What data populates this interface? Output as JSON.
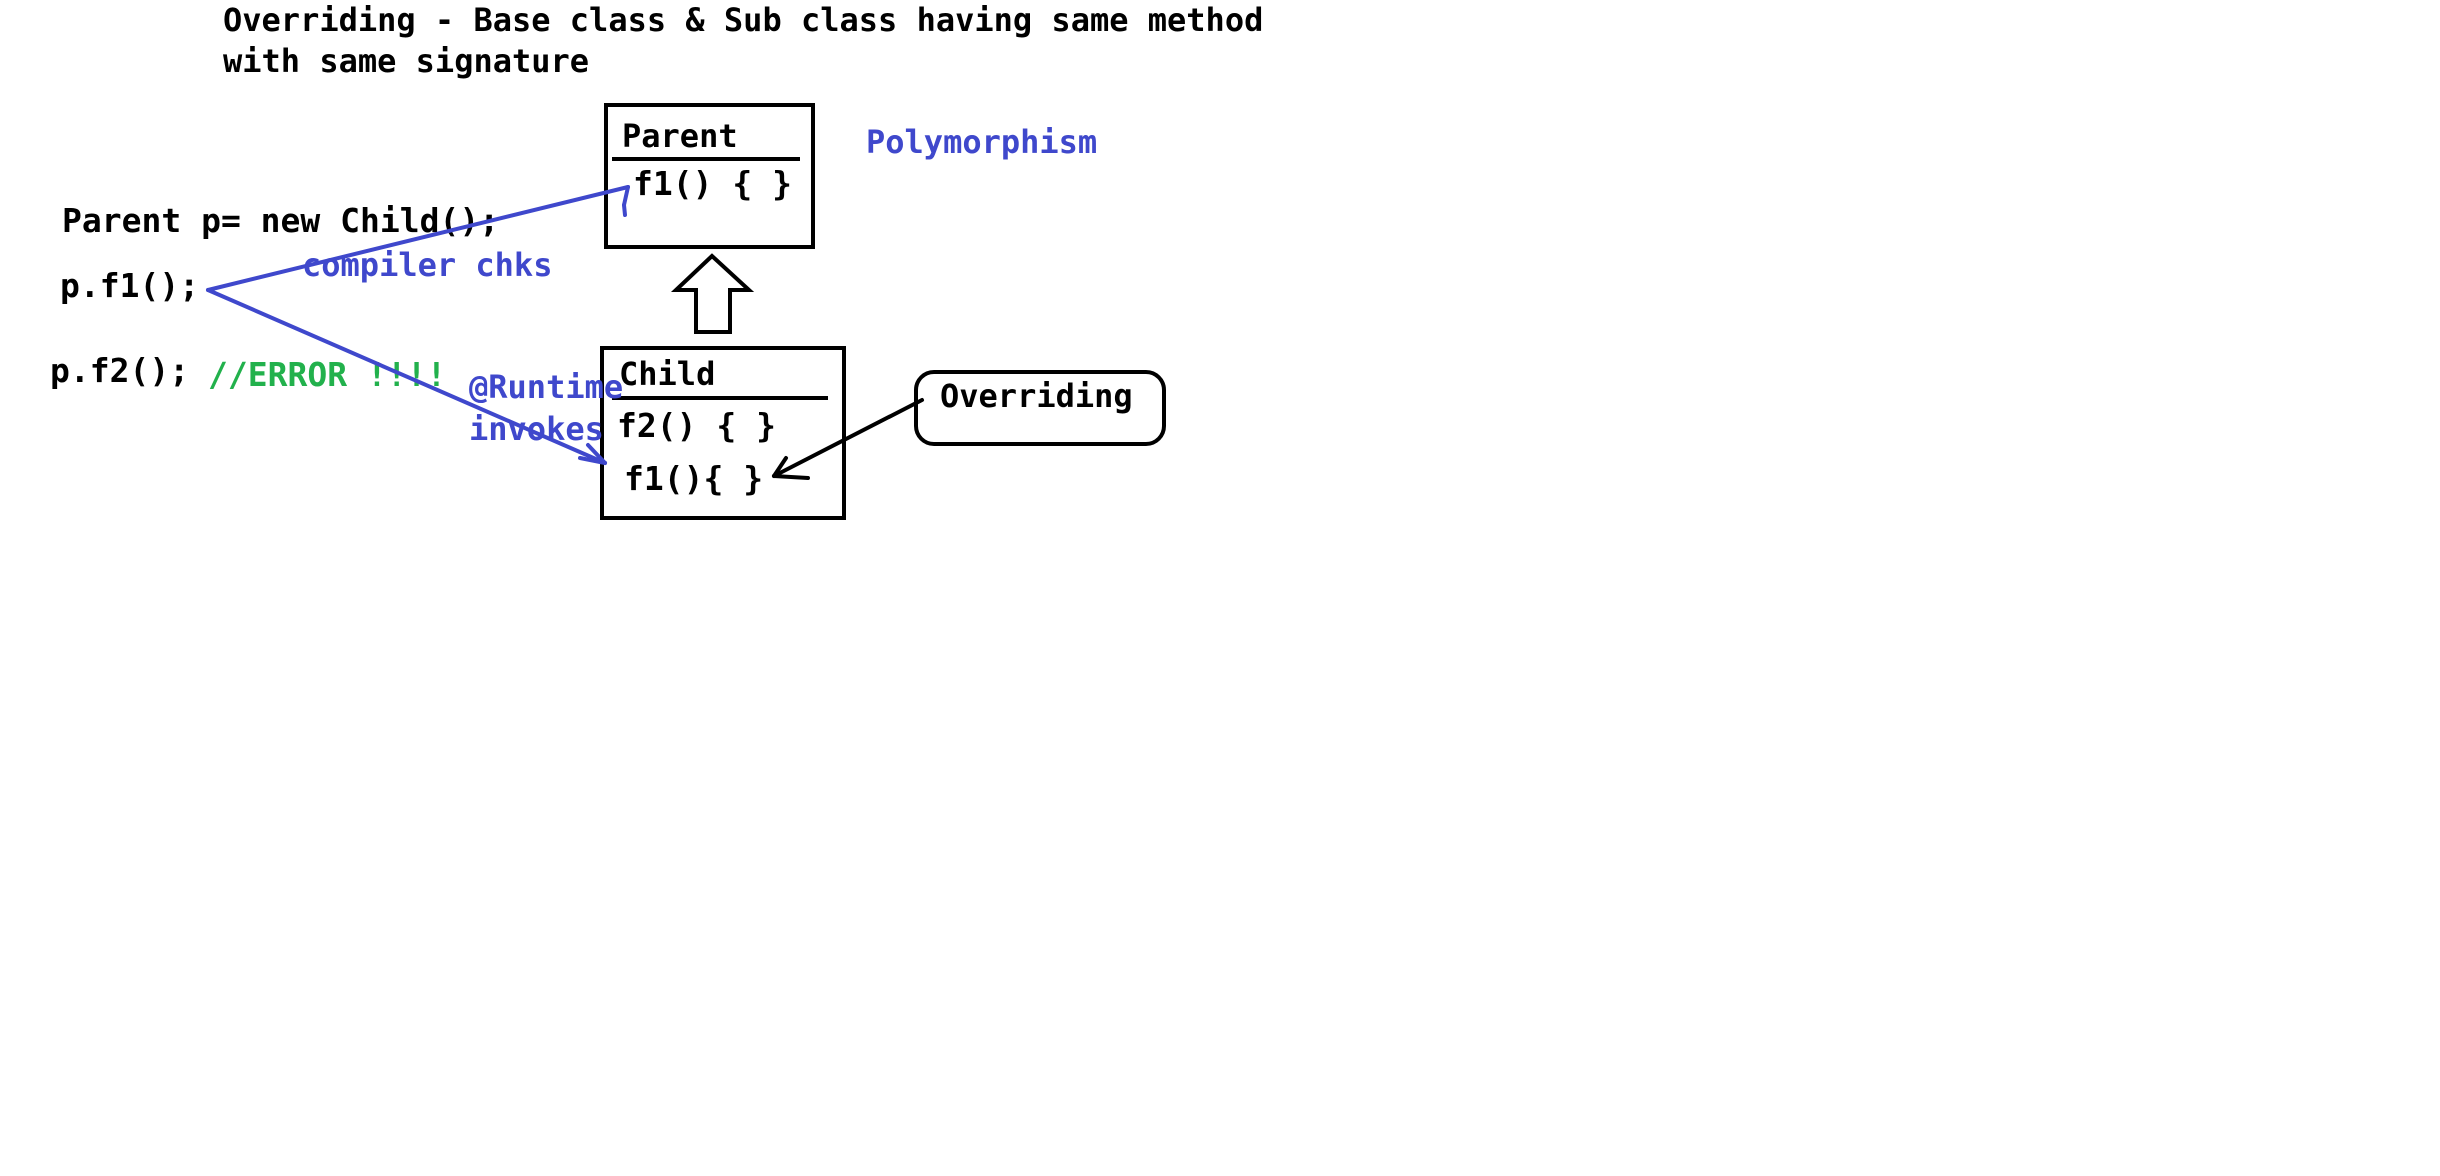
{
  "title": {
    "line1": "Overriding - Base class & Sub class having same method",
    "line2": "with same signature"
  },
  "code": {
    "declaration": "Parent p= new Child();",
    "call_f1": "p.f1();",
    "call_f2": "p.f2();",
    "error_comment": "//ERROR !!!!"
  },
  "parent_class": {
    "name": "Parent",
    "methods": [
      "f1() { }"
    ]
  },
  "child_class": {
    "name": "Child",
    "methods": [
      "f2() { }",
      "f1(){ }"
    ]
  },
  "annotations": {
    "polymorphism": "Polymorphism",
    "compiler_check": "compiler chks",
    "runtime_line1": "@Runtime",
    "runtime_line2": "invokes",
    "overriding": "Overriding"
  },
  "colors": {
    "ink": "#000000",
    "annotation_blue": "#3f48cc",
    "error_green": "#22b14c",
    "background": "#ffffff"
  }
}
